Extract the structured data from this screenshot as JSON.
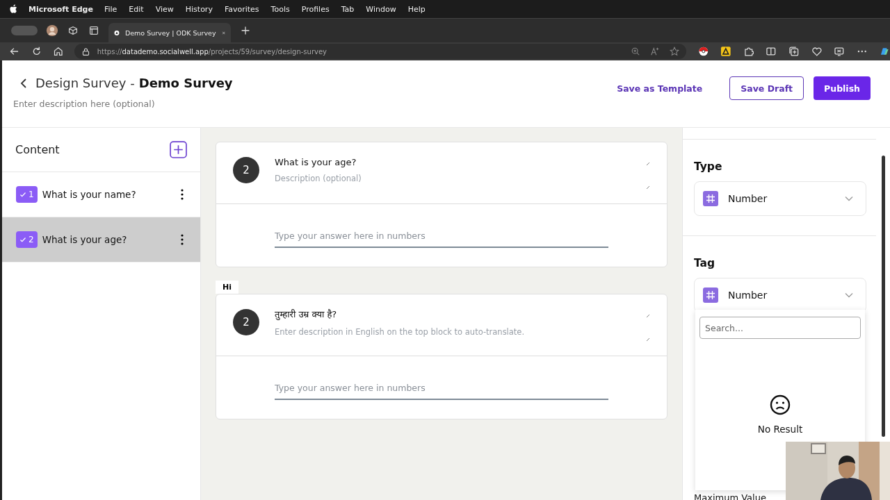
{
  "menubar": {
    "app": "Microsoft Edge",
    "items": [
      "File",
      "Edit",
      "View",
      "History",
      "Favorites",
      "Tools",
      "Profiles",
      "Tab",
      "Window",
      "Help"
    ]
  },
  "browser": {
    "tab_title": "Demo Survey | ODK Survey",
    "url": "https://**datademo.socialwell.app**/projects/59/survey/design-survey"
  },
  "header": {
    "title_prefix": "Design Survey -",
    "title": "Demo Survey",
    "description_placeholder": "Enter description here (optional)",
    "actions": [
      {
        "label": "Save as Template",
        "kind": "link"
      },
      {
        "label": "Save Draft",
        "kind": "outline"
      },
      {
        "label": "Publish",
        "kind": "primary"
      }
    ]
  },
  "sidebar": {
    "heading": "Content",
    "items": [
      {
        "number": "1",
        "label": "What is your name?",
        "checked": true,
        "selected": false
      },
      {
        "number": "2",
        "label": "What is your age?",
        "checked": true,
        "selected": true
      }
    ]
  },
  "questions": [
    {
      "number": "2",
      "title": "What is your age?",
      "description_placeholder": "Description (optional)",
      "answer_placeholder": "Type your answer here in numbers"
    },
    {
      "language": "Hi",
      "number": "2",
      "title": "तुम्हारी उम्र क्या है?",
      "description_placeholder": "Enter description in English on the top block to auto-translate.",
      "answer_placeholder": "Type your answer here in numbers"
    }
  ],
  "settings": {
    "type": {
      "label": "Type",
      "value": "Number"
    },
    "tag": {
      "label": "Tag",
      "value": "Number",
      "expanded": true,
      "search_placeholder": "Search...",
      "empty_text": "No Result"
    },
    "next_label": "Maximum Value"
  }
}
